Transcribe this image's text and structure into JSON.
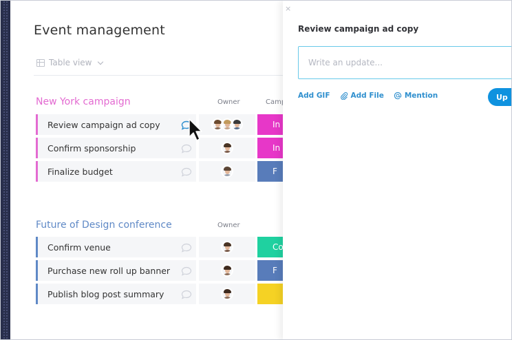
{
  "board": {
    "title": "Event management",
    "view_label": "Table view"
  },
  "groups": [
    {
      "title": "New York campaign",
      "color": "#e36ad1",
      "owner_header": "Owner",
      "status_header": "Camp",
      "rows": [
        {
          "name": "Review campaign ad copy",
          "status": "In",
          "status_color": "#e737c8"
        },
        {
          "name": "Confirm sponsorship",
          "status": "In",
          "status_color": "#e737c8"
        },
        {
          "name": "Finalize budget",
          "status": "F",
          "status_color": "#587cba"
        }
      ]
    },
    {
      "title": "Future of Design conference",
      "color": "#5f89c6",
      "owner_header": "Owner",
      "rows": [
        {
          "name": "Confirm venue",
          "status": "Co",
          "status_color": "#1fd1a0"
        },
        {
          "name": "Purchase new roll up banner",
          "status": "F",
          "status_color": "#587cba"
        },
        {
          "name": "Publish blog post summary",
          "status": "",
          "status_color": "#f5d224"
        }
      ]
    }
  ],
  "panel": {
    "close": "×",
    "title": "Review campaign ad copy",
    "update_placeholder": "Write an update...",
    "add_gif": "Add GIF",
    "add_file": "Add File",
    "mention": "Mention",
    "update_button": "Up"
  },
  "colors": {
    "sidebar": "#292f4c",
    "accent": "#0f92df",
    "input_border": "#67c9e9"
  }
}
